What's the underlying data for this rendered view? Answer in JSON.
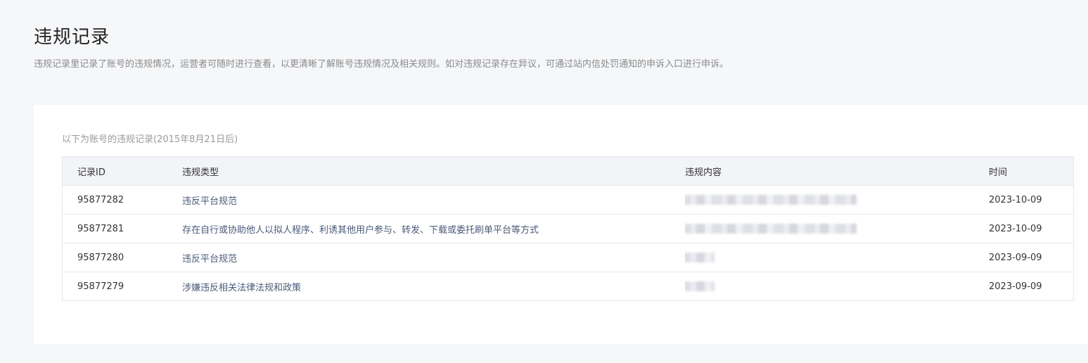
{
  "header": {
    "title": "违规记录",
    "description": "违规记录里记录了账号的违规情况，运营者可随时进行查看，以更清晰了解账号违规情况及相关规则。如对违规记录存在异议，可通过站内信处罚通知的申诉入口进行申诉。"
  },
  "records": {
    "caption": "以下为账号的违规记录(2015年8月21日后)",
    "columns": {
      "id": "记录ID",
      "type": "违规类型",
      "content": "违规内容",
      "time": "时间"
    },
    "rows": [
      {
        "id": "95877282",
        "type": "违反平台规范",
        "time": "2023-10-09"
      },
      {
        "id": "95877281",
        "type": "存在自行或协助他人以拟人程序、利诱其他用户参与、转发、下载或委托刷单平台等方式",
        "time": "2023-10-09"
      },
      {
        "id": "95877280",
        "type": "违反平台规范",
        "time": "2023-09-09"
      },
      {
        "id": "95877279",
        "type": "涉嫌违反相关法律法规和政策",
        "time": "2023-09-09"
      }
    ]
  }
}
